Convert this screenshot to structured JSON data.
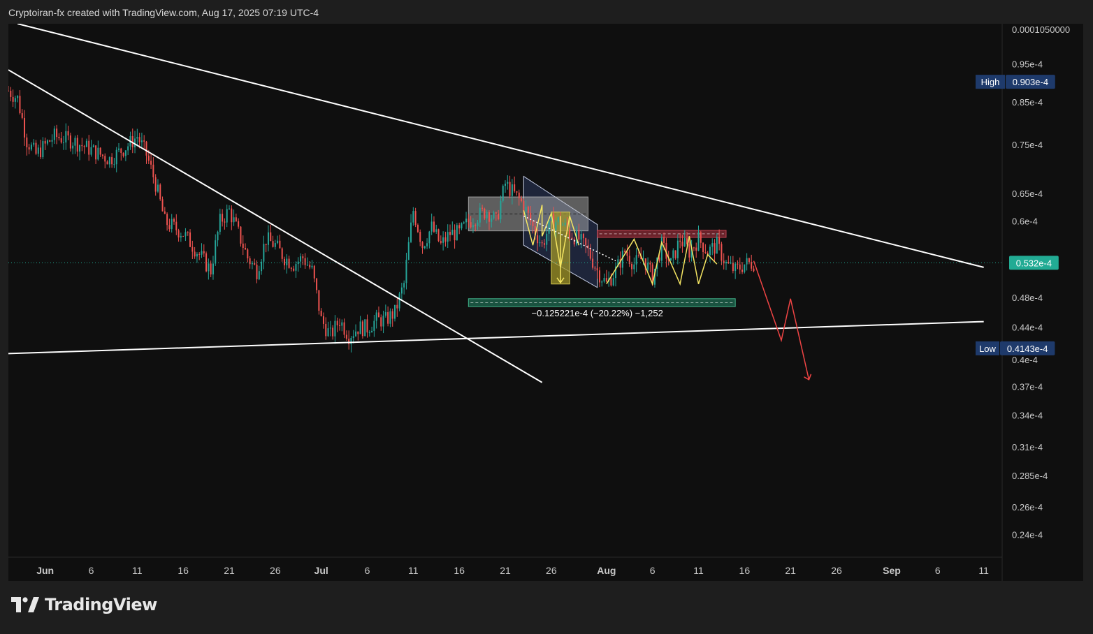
{
  "header": {
    "title": "Cryptoiran-fx created with TradingView.com, Aug 17, 2025 07:19 UTC-4"
  },
  "footer": {
    "brand": "TradingView",
    "logo_icon": "tradingview-logo-icon"
  },
  "colors": {
    "background": "#0f0f0f",
    "frame": "#1e1e1e",
    "up_candle": "#26a69a",
    "down_candle": "#ef5350",
    "trendline": "#ffffff",
    "zigzag": "#f5e663",
    "projection": "#ef4444",
    "current_price_badge": "#22ab94",
    "high_low_badge": "#1e3a6b",
    "target_zone": "#1f6b52",
    "resistance_zone": "#8b2b36"
  },
  "chart_data": {
    "type": "candlestick",
    "y_scale": "log",
    "y_ticks": [
      "0.0001050000",
      "0.95e-4",
      "0.85e-4",
      "0.75e-4",
      "0.65e-4",
      "0.6e-4",
      "0.48e-4",
      "0.44e-4",
      "0.4e-4",
      "0.37e-4",
      "0.34e-4",
      "0.31e-4",
      "0.285e-4",
      "0.26e-4",
      "0.24e-4"
    ],
    "y_tick_values": [
      1.05,
      0.95,
      0.85,
      0.75,
      0.65,
      0.6,
      0.48,
      0.44,
      0.4,
      0.37,
      0.34,
      0.31,
      0.285,
      0.26,
      0.24
    ],
    "y_unit": "e-4",
    "ylim": [
      0.225,
      1.07
    ],
    "x_ticks": [
      {
        "label": "Jun",
        "date": "2025-06-01",
        "bold": true
      },
      {
        "label": "6",
        "date": "2025-06-06"
      },
      {
        "label": "11",
        "date": "2025-06-11"
      },
      {
        "label": "16",
        "date": "2025-06-16"
      },
      {
        "label": "21",
        "date": "2025-06-21"
      },
      {
        "label": "26",
        "date": "2025-06-26"
      },
      {
        "label": "Jul",
        "date": "2025-07-01",
        "bold": true
      },
      {
        "label": "6",
        "date": "2025-07-06"
      },
      {
        "label": "11",
        "date": "2025-07-11"
      },
      {
        "label": "16",
        "date": "2025-07-16"
      },
      {
        "label": "21",
        "date": "2025-07-21"
      },
      {
        "label": "26",
        "date": "2025-07-26"
      },
      {
        "label": "Aug",
        "date": "2025-08-01",
        "bold": true
      },
      {
        "label": "6",
        "date": "2025-08-06"
      },
      {
        "label": "11",
        "date": "2025-08-11"
      },
      {
        "label": "16",
        "date": "2025-08-16"
      },
      {
        "label": "21",
        "date": "2025-08-21"
      },
      {
        "label": "26",
        "date": "2025-08-26"
      },
      {
        "label": "Sep",
        "date": "2025-09-01",
        "bold": true
      },
      {
        "label": "6",
        "date": "2025-09-06"
      },
      {
        "label": "11",
        "date": "2025-09-11"
      }
    ],
    "xlim": [
      "2025-05-28",
      "2025-09-13"
    ],
    "price_path": [
      [
        "2025-05-28",
        0.88
      ],
      [
        "2025-05-29",
        0.86
      ],
      [
        "2025-05-30",
        0.76
      ],
      [
        "2025-05-31",
        0.73
      ],
      [
        "2025-06-02",
        0.77
      ],
      [
        "2025-06-04",
        0.76
      ],
      [
        "2025-06-06",
        0.74
      ],
      [
        "2025-06-08",
        0.72
      ],
      [
        "2025-06-10",
        0.75
      ],
      [
        "2025-06-11",
        0.77
      ],
      [
        "2025-06-12",
        0.73
      ],
      [
        "2025-06-13",
        0.67
      ],
      [
        "2025-06-14",
        0.6
      ],
      [
        "2025-06-16",
        0.58
      ],
      [
        "2025-06-18",
        0.54
      ],
      [
        "2025-06-19",
        0.52
      ],
      [
        "2025-06-20",
        0.6
      ],
      [
        "2025-06-21",
        0.62
      ],
      [
        "2025-06-22",
        0.58
      ],
      [
        "2025-06-23",
        0.54
      ],
      [
        "2025-06-24",
        0.52
      ],
      [
        "2025-06-25",
        0.57
      ],
      [
        "2025-06-26",
        0.56
      ],
      [
        "2025-06-27",
        0.54
      ],
      [
        "2025-06-28",
        0.53
      ],
      [
        "2025-06-29",
        0.54
      ],
      [
        "2025-06-30",
        0.52
      ],
      [
        "2025-07-01",
        0.45
      ],
      [
        "2025-07-02",
        0.43
      ],
      [
        "2025-07-03",
        0.45
      ],
      [
        "2025-07-04",
        0.43
      ],
      [
        "2025-07-05",
        0.44
      ],
      [
        "2025-07-06",
        0.44
      ],
      [
        "2025-07-07",
        0.45
      ],
      [
        "2025-07-08",
        0.45
      ],
      [
        "2025-07-09",
        0.46
      ],
      [
        "2025-07-10",
        0.5
      ],
      [
        "2025-07-11",
        0.62
      ],
      [
        "2025-07-12",
        0.56
      ],
      [
        "2025-07-13",
        0.59
      ],
      [
        "2025-07-14",
        0.56
      ],
      [
        "2025-07-15",
        0.58
      ],
      [
        "2025-07-16",
        0.58
      ],
      [
        "2025-07-17",
        0.6
      ],
      [
        "2025-07-18",
        0.61
      ],
      [
        "2025-07-19",
        0.62
      ],
      [
        "2025-07-20",
        0.6
      ],
      [
        "2025-07-21",
        0.67
      ],
      [
        "2025-07-22",
        0.65
      ],
      [
        "2025-07-23",
        0.63
      ],
      [
        "2025-07-24",
        0.59
      ],
      [
        "2025-07-25",
        0.56
      ],
      [
        "2025-07-26",
        0.6
      ],
      [
        "2025-07-27",
        0.6
      ],
      [
        "2025-07-28",
        0.58
      ],
      [
        "2025-07-29",
        0.57
      ],
      [
        "2025-07-30",
        0.55
      ],
      [
        "2025-07-31",
        0.52
      ],
      [
        "2025-08-01",
        0.5
      ],
      [
        "2025-08-02",
        0.52
      ],
      [
        "2025-08-03",
        0.55
      ],
      [
        "2025-08-04",
        0.53
      ],
      [
        "2025-08-05",
        0.54
      ],
      [
        "2025-08-06",
        0.51
      ],
      [
        "2025-08-07",
        0.56
      ],
      [
        "2025-08-08",
        0.53
      ],
      [
        "2025-08-09",
        0.57
      ],
      [
        "2025-08-10",
        0.55
      ],
      [
        "2025-08-11",
        0.57
      ],
      [
        "2025-08-12",
        0.55
      ],
      [
        "2025-08-13",
        0.56
      ],
      [
        "2025-08-14",
        0.53
      ],
      [
        "2025-08-15",
        0.52
      ],
      [
        "2025-08-16",
        0.53
      ],
      [
        "2025-08-17",
        0.532
      ]
    ],
    "current_price": {
      "label": "0.532e-4",
      "value": 0.532
    },
    "high": {
      "label": "High",
      "value_label": "0.903e-4",
      "value": 0.903
    },
    "low": {
      "label": "Low",
      "value_label": "0.4143e-4",
      "value": 0.4143
    },
    "measure_label": "−0.125221e-4 (−20.22%) −1,252",
    "trendlines": [
      {
        "name": "upper-descending-trendline",
        "from": [
          "2025-05-29",
          1.07
        ],
        "to": [
          "2025-09-11",
          0.525
        ]
      },
      {
        "name": "steep-descending-trendline",
        "from": [
          "2025-05-28",
          0.935
        ],
        "to": [
          "2025-07-25",
          0.375
        ]
      },
      {
        "name": "ascending-support-trendline",
        "from": [
          "2025-05-28",
          0.408
        ],
        "to": [
          "2025-09-11",
          0.448
        ]
      }
    ],
    "zones": [
      {
        "name": "grey-range-box",
        "from": [
          "2025-07-17",
          0.645
        ],
        "to": [
          "2025-07-30",
          0.584
        ]
      },
      {
        "name": "resistance-zone",
        "from": [
          "2025-07-31",
          0.585
        ],
        "to": [
          "2025-08-14",
          0.573
        ]
      },
      {
        "name": "target-zone",
        "from": [
          "2025-07-17",
          0.479
        ],
        "to": [
          "2025-08-15",
          0.468
        ]
      },
      {
        "name": "yellow-drop-box",
        "from": [
          "2025-07-26",
          0.617
        ],
        "to": [
          "2025-07-28",
          0.5
        ]
      }
    ],
    "channel": [
      [
        "2025-07-23",
        0.685
      ],
      [
        "2025-07-31",
        0.595
      ],
      [
        "2025-07-31",
        0.495
      ],
      [
        "2025-07-23",
        0.56
      ]
    ],
    "zigzag": [
      [
        "2025-07-23",
        0.62
      ],
      [
        "2025-07-24",
        0.56
      ],
      [
        "2025-07-25",
        0.63
      ],
      [
        "2025-07-25",
        0.575
      ],
      [
        "2025-07-26",
        0.615
      ],
      [
        "2025-07-27",
        0.525
      ],
      [
        "2025-07-28",
        0.61
      ],
      [
        "2025-07-29",
        0.56
      ]
    ],
    "zigzag_range": [
      [
        "2025-08-01",
        0.5
      ],
      [
        "2025-08-04",
        0.57
      ],
      [
        "2025-08-06",
        0.5
      ],
      [
        "2025-08-07",
        0.565
      ],
      [
        "2025-08-09",
        0.5
      ],
      [
        "2025-08-10",
        0.575
      ],
      [
        "2025-08-11",
        0.5
      ],
      [
        "2025-08-12",
        0.545
      ],
      [
        "2025-08-13",
        0.53
      ]
    ],
    "projection": [
      [
        "2025-08-17",
        0.535
      ],
      [
        "2025-08-20",
        0.424
      ],
      [
        "2025-08-21",
        0.479
      ],
      [
        "2025-08-23",
        0.378
      ]
    ]
  }
}
